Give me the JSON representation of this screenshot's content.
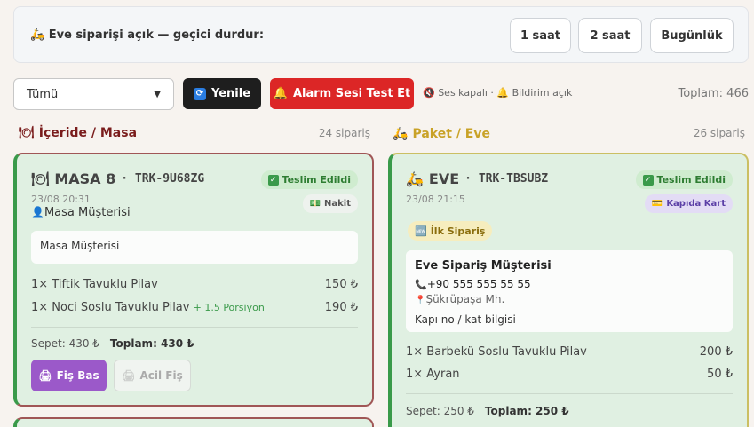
{
  "topbar": {
    "message": "Eve siparişi açık — geçici durdur:",
    "pause_options": [
      "1 saat",
      "2 saat",
      "Bugünlük"
    ]
  },
  "toolbar": {
    "filter_value": "Tümü",
    "refresh_label": "Yenile",
    "alarm_label": "Alarm Sesi Test Et",
    "status_text": "Ses kapalı · 🔔 Bildirim açık",
    "total_label": "Toplam: 466"
  },
  "columns": {
    "inside": {
      "title": "İçeride / Masa",
      "count": "24 sipariş"
    },
    "delivery": {
      "title": "Paket / Eve",
      "count": "26 sipariş"
    }
  },
  "cards": {
    "masa": {
      "title": "MASA 8",
      "code": "TRK-9U68ZG",
      "date": "23/08 20:31",
      "customer": "Masa Müşterisi",
      "status_badge": "Teslim Edildi",
      "payment_badge": "Nakit",
      "note": "Masa Müşterisi",
      "items": [
        {
          "name": "1× Tiftik Tavuklu Pilav",
          "extra": "",
          "price": "150 ₺"
        },
        {
          "name": "1× Noci Soslu Tavuklu Pilav",
          "extra": "+ 1.5 Porsiyon",
          "price": "190 ₺"
        }
      ],
      "subtotal": "Sepet: 430 ₺",
      "total": "Toplam: 430 ₺",
      "print_label": "Fiş Bas",
      "urgent_label": "Acil Fiş"
    },
    "eve": {
      "title": "EVE",
      "code": "TRK-TBSUBZ",
      "date": "23/08 21:15",
      "status_badge": "Teslim Edildi",
      "payment_badge": "Kapıda Kart",
      "first_order_badge": "İlk Sipariş",
      "customer_name": "Eve Sipariş Müşterisi",
      "phone": "+90 555 555 55 55",
      "district": "Şükrüpaşa Mh.",
      "address_note": "Kapı no / kat bilgisi",
      "items": [
        {
          "name": "1× Barbekü Soslu Tavuklu Pilav",
          "price": "200 ₺"
        },
        {
          "name": "1× Ayran",
          "price": "50 ₺"
        }
      ],
      "subtotal": "Sepet: 250 ₺",
      "total": "Toplam: 250 ₺"
    }
  },
  "colors": {
    "card_bg": "#e0f0e2",
    "accent_green": "#3a9a4a",
    "alarm_red": "#dc2626",
    "print_purple": "#9b59c9",
    "column_inside": "#7a1c1c",
    "column_delivery": "#c9a227"
  }
}
